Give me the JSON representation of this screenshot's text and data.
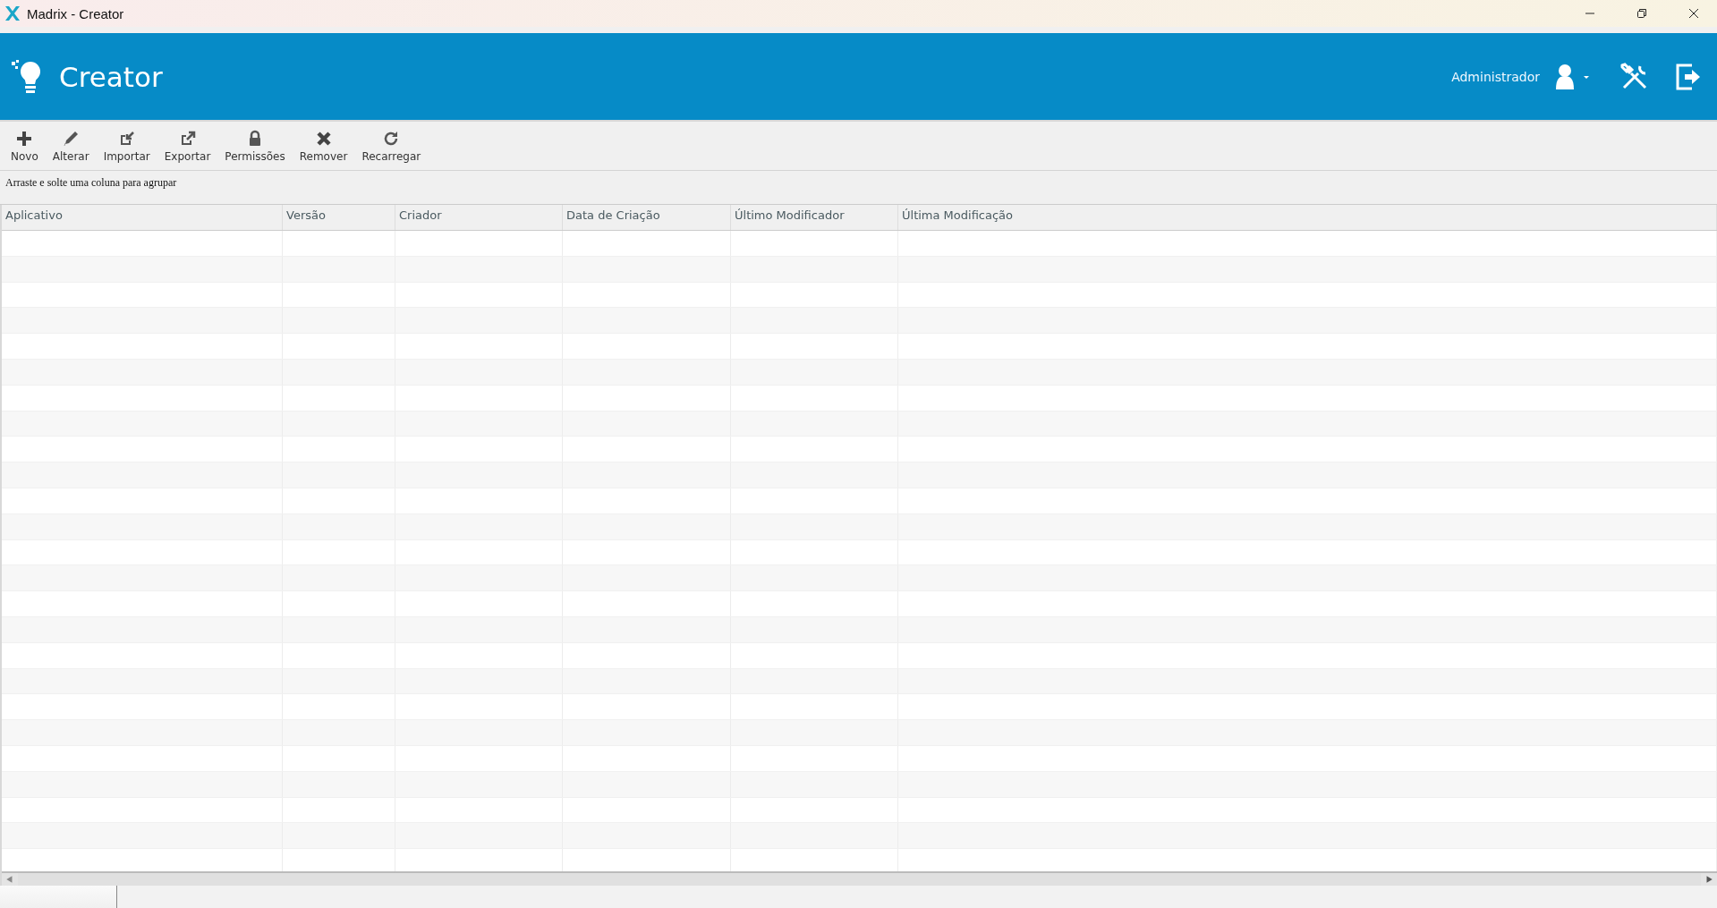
{
  "window": {
    "title": "Madrix - Creator"
  },
  "header": {
    "title": "Creator",
    "user": "Administrador"
  },
  "toolbar": [
    {
      "label": "Novo"
    },
    {
      "label": "Alterar"
    },
    {
      "label": "Importar"
    },
    {
      "label": "Exportar"
    },
    {
      "label": "Permissões"
    },
    {
      "label": "Remover"
    },
    {
      "label": "Recarregar"
    }
  ],
  "group_hint": "Arraste e solte uma coluna para agrupar",
  "table": {
    "columns": [
      "Aplicativo",
      "Versão",
      "Criador",
      "Data de Criação",
      "Último Modificador",
      "Última Modificação"
    ]
  }
}
